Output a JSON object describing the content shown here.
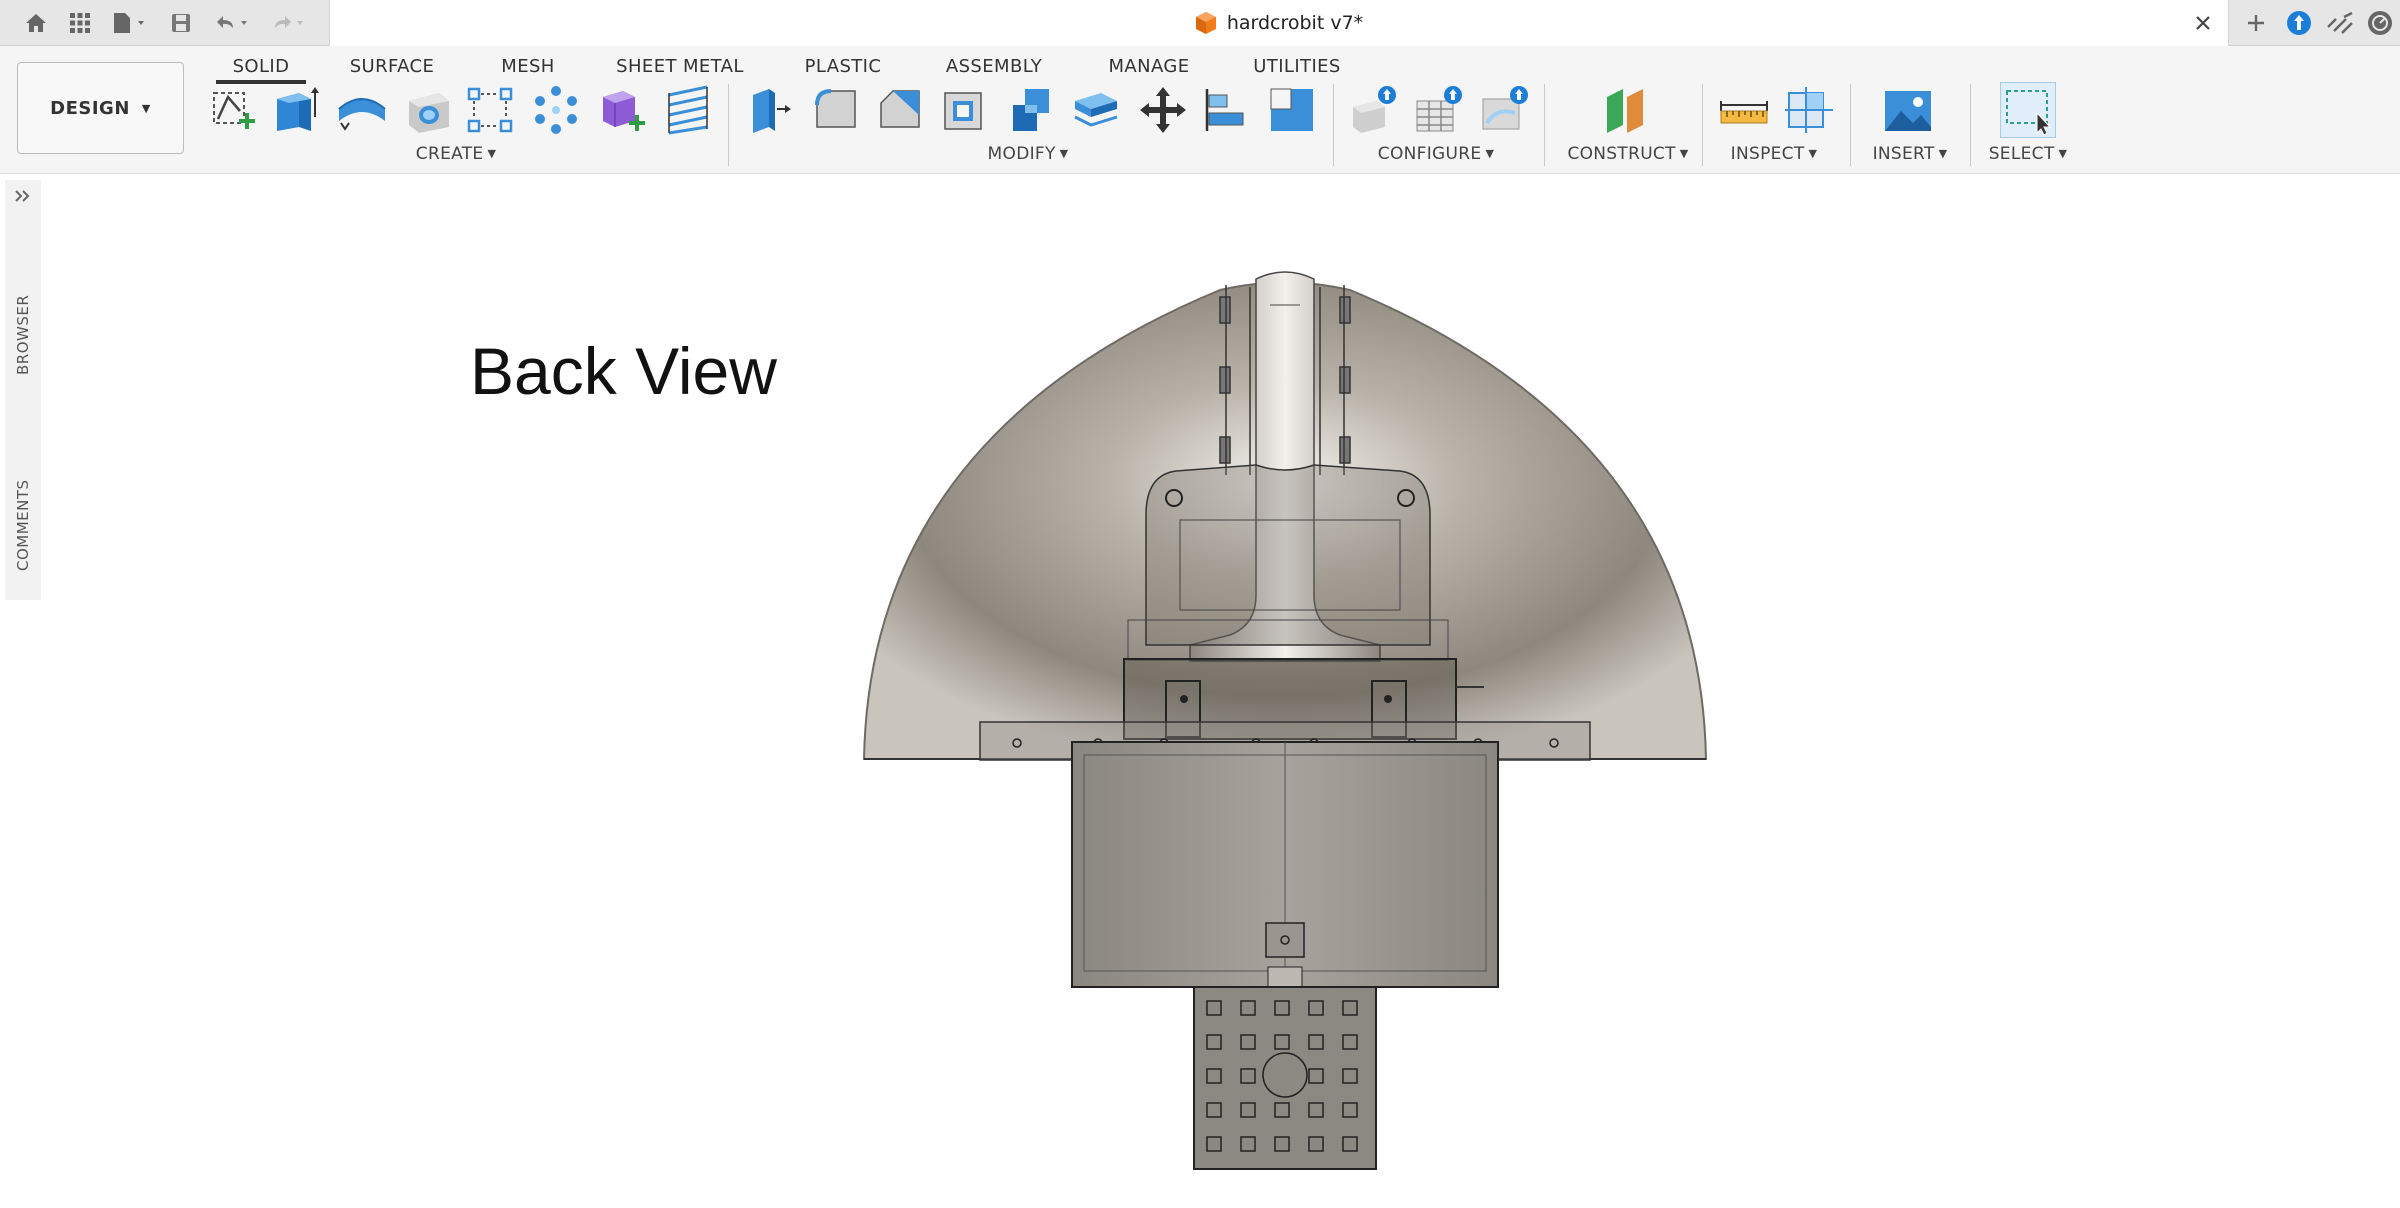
{
  "window": {
    "document_title": "hardcrobit v7*"
  },
  "workspace": {
    "label": "DESIGN"
  },
  "tabs": [
    {
      "label": "SOLID",
      "active": true
    },
    {
      "label": "SURFACE"
    },
    {
      "label": "MESH"
    },
    {
      "label": "SHEET METAL"
    },
    {
      "label": "PLASTIC"
    },
    {
      "label": "ASSEMBLY"
    },
    {
      "label": "MANAGE"
    },
    {
      "label": "UTILITIES"
    }
  ],
  "groups": {
    "create": "CREATE",
    "modify": "MODIFY",
    "configure": "CONFIGURE",
    "construct": "CONSTRUCT",
    "inspect": "INSPECT",
    "insert": "INSERT",
    "select": "SELECT"
  },
  "side_panel": {
    "browser": "BROWSER",
    "comments": "COMMENTS"
  },
  "viewport": {
    "view_label": "Back View"
  },
  "colors": {
    "accent_blue": "#3b8fd9",
    "upgrade_blue": "#1c7ed6",
    "file_orange": "#f07d1a"
  }
}
